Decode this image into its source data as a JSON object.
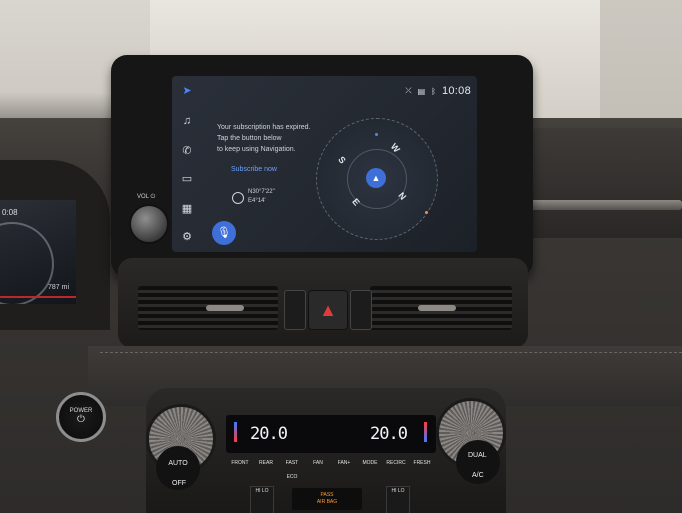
{
  "infotainment": {
    "status": {
      "time": "10:08",
      "icons": [
        "no-signal-icon",
        "battery-icon",
        "bluetooth-icon"
      ]
    },
    "side_rail": [
      "navigation-arrow-icon",
      "music-note-icon",
      "phone-icon",
      "car-icon",
      "apps-grid-icon",
      "settings-gear-icon"
    ],
    "message_line1": "Your subscription has expired.",
    "message_line2": "Tap the button below",
    "message_line3": "to keep using Navigation.",
    "subscribe_label": "Subscribe now",
    "coord_lat": "N30°7'22\"",
    "coord_lon": "E4°14'",
    "compass": {
      "n": "N",
      "s": "S",
      "e": "E",
      "w": "W"
    },
    "knob_label": "VOL ⏻",
    "accent_color": "#3f6fd9"
  },
  "cluster": {
    "time": "0:08",
    "odometer": "787 mi"
  },
  "power_button": {
    "label": "POWER"
  },
  "climate": {
    "left_temp": "20.0",
    "right_temp": "20.0",
    "auto_label": "AUTO",
    "off_label": "OFF",
    "dual_label": "DUAL",
    "ac_label": "A/C",
    "buttons": [
      "FRONT",
      "REAR",
      "FAST ECO",
      "FAN",
      "FAN+",
      "MODE",
      "RECIRC",
      "FRESH"
    ],
    "airbag_line1": "PASS",
    "airbag_line2": "AIR BAG",
    "seat_left": "HI LO",
    "seat_right": "HI LO"
  }
}
